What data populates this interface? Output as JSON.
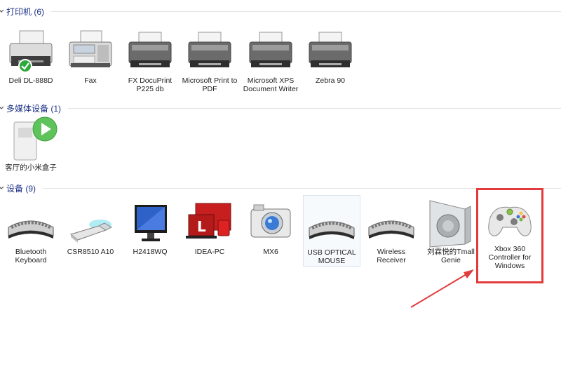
{
  "groups": {
    "printers": {
      "title": "打印机 (6)",
      "items": [
        {
          "label": "Deli DL-888D",
          "icon": "printer-default-icon"
        },
        {
          "label": "Fax",
          "icon": "fax-icon"
        },
        {
          "label": "FX DocuPrint P225 db",
          "icon": "printer-icon"
        },
        {
          "label": "Microsoft Print to PDF",
          "icon": "printer-icon"
        },
        {
          "label": "Microsoft XPS Document Writer",
          "icon": "printer-icon"
        },
        {
          "label": "Zebra 90",
          "icon": "printer-icon"
        }
      ]
    },
    "media": {
      "title": "多媒体设备 (1)",
      "items": [
        {
          "label": "客厅的小米盒子",
          "icon": "media-box-icon"
        }
      ]
    },
    "devices": {
      "title": "设备 (9)",
      "items": [
        {
          "label": "Bluetooth Keyboard",
          "icon": "keyboard-icon"
        },
        {
          "label": "CSR8510 A10",
          "icon": "usb-dongle-icon"
        },
        {
          "label": "H2418WQ",
          "icon": "monitor-icon"
        },
        {
          "label": "IDEA-PC",
          "icon": "computer-icon"
        },
        {
          "label": "MX6",
          "icon": "camera-icon"
        },
        {
          "label": "USB OPTICAL MOUSE",
          "icon": "keyboard-icon"
        },
        {
          "label": "Wireless Receiver",
          "icon": "keyboard-icon"
        },
        {
          "label": "刘霖悦的Tmall Genie",
          "icon": "speaker-icon"
        },
        {
          "label": "Xbox 360 Controller for Windows",
          "icon": "gamepad-icon"
        }
      ]
    }
  },
  "colors": {
    "group_title": "#1e3287",
    "callout": "#e23b3b",
    "check_green": "#2fa83a"
  }
}
